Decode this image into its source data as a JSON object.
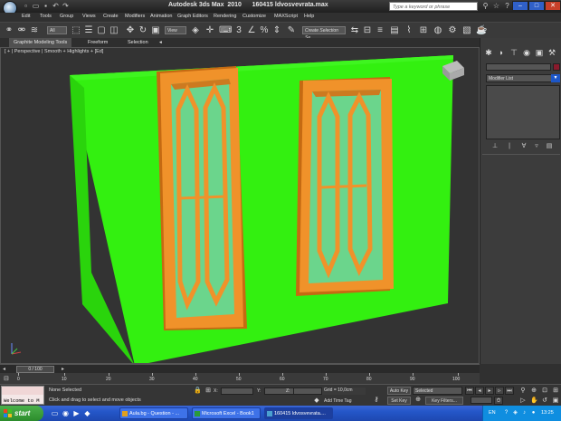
{
  "window": {
    "title": "Autodesk 3ds Max  2010      160415 ldvosvevrata.max",
    "search_placeholder": "Type a keyword or phrase"
  },
  "menu": [
    "Edit",
    "Tools",
    "Group",
    "Views",
    "Create",
    "Modifiers",
    "Animation",
    "Graph Editors",
    "Rendering",
    "Customize",
    "MAXScript",
    "Help"
  ],
  "toolbar": {
    "filter_value": "All",
    "view_value": "View",
    "selection_set_placeholder": "Create Selection Se"
  },
  "ribbon": {
    "tabs": [
      "Graphite Modeling Tools",
      "Freeform",
      "Selection"
    ]
  },
  "viewport": {
    "label": "[ + ] [ Perspective ] [ Smooth + Highlights + EdgedFaces ]",
    "label_display": "[ + | Perspective | Smooth + Highlights + [Ed]",
    "colors": {
      "background": "#333333",
      "wall": "#33f010",
      "frame": "#f0922a",
      "glass": "#6bd58c"
    }
  },
  "command_panel": {
    "modifier_list": "Modifier List"
  },
  "timeline": {
    "slider_label": "0 / 100",
    "ticks": [
      "0",
      "10",
      "20",
      "30",
      "40",
      "50",
      "60",
      "70",
      "80",
      "90",
      "100"
    ]
  },
  "status": {
    "maxscript_text": "Welcome to M",
    "selection": "None Selected",
    "prompt": "Click and drag to select and move objects",
    "x_label": "X:",
    "y_label": "Y:",
    "z_label": "Z:",
    "grid": "Grid = 10,0cm",
    "add_time_tag": "Add Time Tag",
    "auto_key": "Auto Key",
    "set_key": "Set Key",
    "selected": "Selected",
    "key_filters": "Key Filters..."
  },
  "taskbar": {
    "start_label": "start",
    "tasks": [
      {
        "label": "Aula.bg - Question - ...",
        "icon_color": "#e0a020"
      },
      {
        "label": "Microsoft Excel - Book1",
        "icon_color": "#2a9a3a"
      },
      {
        "label": "160415 ldvosvevrata....",
        "icon_color": "#4aa0d0"
      }
    ],
    "language": "EN",
    "clock": "13:25"
  }
}
